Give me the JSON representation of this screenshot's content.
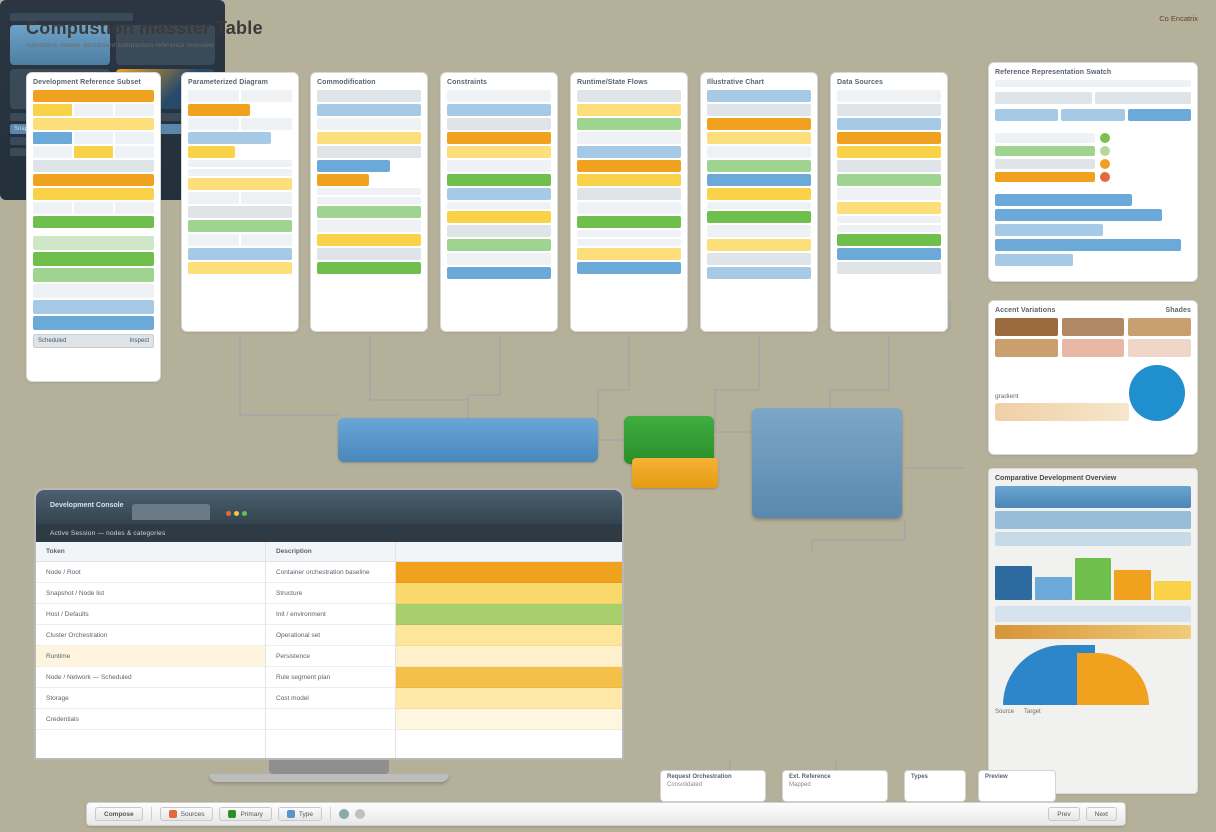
{
  "header": {
    "title": "Compustion masster Table",
    "subtitle": "Interactive master dashboard comparison reference overview"
  },
  "top_right_label": "Co Encatrix",
  "card_a": {
    "header": "Development Reference Subset",
    "footer_left": "Scheduled",
    "footer_right": "Inspect"
  },
  "cards_top": [
    {
      "header": "Parameterized Diagram"
    },
    {
      "header": "Commodification"
    },
    {
      "header": "Constraints"
    },
    {
      "header": "Runtime/State Flows"
    },
    {
      "header": "Illustrative Chart"
    },
    {
      "header": "Data Sources"
    }
  ],
  "right_panel_1": {
    "header": "Reference Representation Swatch"
  },
  "right_panel_2": {
    "header_left": "Accent Variations",
    "header_right": "Shades"
  },
  "right_panel_3": {
    "header": "Comparative Development Overview",
    "tag_a": "Source",
    "tag_b": "Target"
  },
  "monitor": {
    "window_title": "Development Console",
    "sub_label": "Active Session — nodes & categories",
    "table_header_left": "Token",
    "table_header_right": "Description",
    "rows": [
      {
        "l": "Node / Root",
        "r": "Container orchestration baseline"
      },
      {
        "l": "Snapshot / Node list",
        "r": "Structure"
      },
      {
        "l": "Host / Defaults",
        "r": "Init / environment"
      },
      {
        "l": "Cluster Orchestration",
        "r": "Operational set"
      },
      {
        "l": "Runtime",
        "r": "Persistence",
        "highlight": true
      },
      {
        "l": "Node / Network — Scheduled",
        "r": "Rule segment plan"
      },
      {
        "l": "Storage",
        "r": "Cost model"
      },
      {
        "l": "Credentials",
        "r": ""
      }
    ]
  },
  "mini_dash": {
    "pill": "Snapshot"
  },
  "chips": [
    {
      "h": "Request Orchestration",
      "v": "Consolidated"
    },
    {
      "h": "Ext. Reference",
      "v": "Mapped"
    },
    {
      "h": "Types",
      "v": ""
    },
    {
      "h": "Preview",
      "v": ""
    }
  ],
  "taskbar": {
    "start": "Compose",
    "items": [
      "Sources",
      "Primary",
      "Type"
    ],
    "right": [
      "Prev",
      "Next"
    ]
  }
}
